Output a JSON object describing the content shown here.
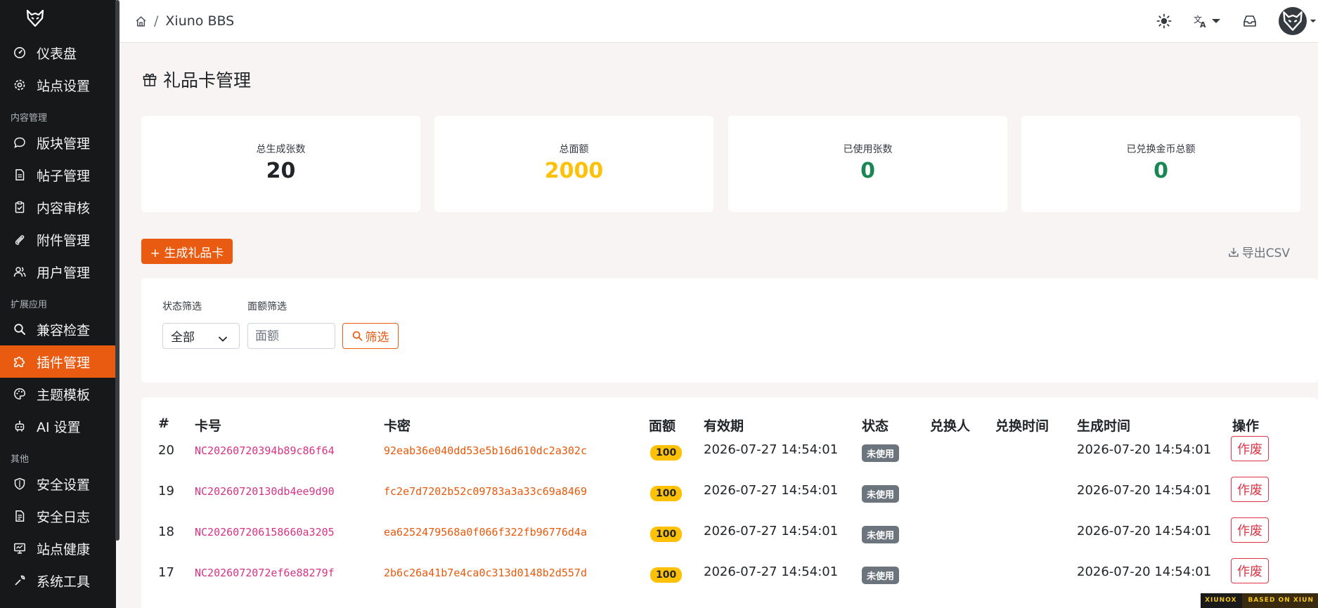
{
  "sidebar": {
    "logo_icon": "wolf-logo-icon",
    "items_top": [
      {
        "label": "仪表盘",
        "icon": "dashboard-icon"
      },
      {
        "label": "站点设置",
        "icon": "gear-icon"
      }
    ],
    "section_content": "内容管理",
    "items_content": [
      {
        "label": "版块管理",
        "icon": "chat-bubble-icon"
      },
      {
        "label": "帖子管理",
        "icon": "document-icon"
      },
      {
        "label": "内容审核",
        "icon": "clipboard-check-icon"
      },
      {
        "label": "附件管理",
        "icon": "paperclip-icon"
      },
      {
        "label": "用户管理",
        "icon": "users-icon"
      }
    ],
    "section_ext": "扩展应用",
    "items_ext": [
      {
        "label": "兼容检查",
        "icon": "search-icon"
      },
      {
        "label": "插件管理",
        "icon": "puzzle-icon",
        "active": true
      },
      {
        "label": "主题模板",
        "icon": "palette-icon"
      },
      {
        "label": "AI 设置",
        "icon": "robot-icon"
      }
    ],
    "section_other": "其他",
    "items_other": [
      {
        "label": "安全设置",
        "icon": "shield-icon"
      },
      {
        "label": "安全日志",
        "icon": "log-icon"
      },
      {
        "label": "站点健康",
        "icon": "monitor-icon"
      },
      {
        "label": "系统工具",
        "icon": "tools-icon"
      }
    ]
  },
  "header": {
    "home_icon": "home-icon",
    "separator": "/",
    "breadcrumb": "Xiuno BBS",
    "theme_icon": "sun-icon",
    "language_icon": "translate-icon",
    "inbox_icon": "inbox-icon",
    "avatar_icon": "avatar-icon"
  },
  "page": {
    "title": "礼品卡管理",
    "title_icon": "gift-icon"
  },
  "stats": [
    {
      "label": "总生成张数",
      "value": "20",
      "color": "#212529"
    },
    {
      "label": "总面额",
      "value": "2000",
      "color": "#ffc107"
    },
    {
      "label": "已使用张数",
      "value": "0",
      "color": "#198754"
    },
    {
      "label": "已兑换金币总额",
      "value": "0",
      "color": "#198754"
    }
  ],
  "actions": {
    "generate_label": "+ 生成礼品卡",
    "export_label": "导出CSV",
    "export_icon": "download-icon"
  },
  "filters": {
    "status_label": "状态筛选",
    "status_value": "全部",
    "amount_label": "面额筛选",
    "amount_placeholder": "面额",
    "submit_label": "筛选",
    "submit_icon": "search-icon"
  },
  "table": {
    "columns": [
      "#",
      "卡号",
      "卡密",
      "面额",
      "有效期",
      "状态",
      "兑换人",
      "兑换时间",
      "生成时间",
      "操作"
    ],
    "rows": [
      {
        "id": "20",
        "card_no": "NC20260720394b89c86f64",
        "card_pw": "92eab36e040dd53e5b16d610dc2a302c",
        "amount": "100",
        "expires": "2026-07-27 14:54:01",
        "status": "未使用",
        "redeemer": "",
        "redeemed_at": "",
        "created_at": "2026-07-20 14:54:01",
        "action": "作废"
      },
      {
        "id": "19",
        "card_no": "NC20260720130db4ee9d90",
        "card_pw": "fc2e7d7202b52c09783a3a33c69a8469",
        "amount": "100",
        "expires": "2026-07-27 14:54:01",
        "status": "未使用",
        "redeemer": "",
        "redeemed_at": "",
        "created_at": "2026-07-20 14:54:01",
        "action": "作废"
      },
      {
        "id": "18",
        "card_no": "NC202607206158660a3205",
        "card_pw": "ea6252479568a0f066f322fb96776d4a",
        "amount": "100",
        "expires": "2026-07-27 14:54:01",
        "status": "未使用",
        "redeemer": "",
        "redeemed_at": "",
        "created_at": "2026-07-20 14:54:01",
        "action": "作废"
      },
      {
        "id": "17",
        "card_no": "NC2026072072ef6e88279f",
        "card_pw": "2b6c26a41b7e4ca0c313d0148b2d557d",
        "amount": "100",
        "expires": "2026-07-27 14:54:01",
        "status": "未使用",
        "redeemer": "",
        "redeemed_at": "",
        "created_at": "2026-07-20 14:54:01",
        "action": "作废"
      }
    ]
  },
  "footer": {
    "badge_left": "XIUNOX",
    "badge_right": "BASED ON XIUN"
  },
  "colors": {
    "accent": "#ea5b12",
    "sidebar_bg": "#17181a",
    "page_bg": "#f8f4f3",
    "danger": "#dc3545",
    "amount_badge": "#ffc107",
    "status_badge": "#6c757d",
    "card_no": "#d63384",
    "card_pw": "#e8590c"
  }
}
